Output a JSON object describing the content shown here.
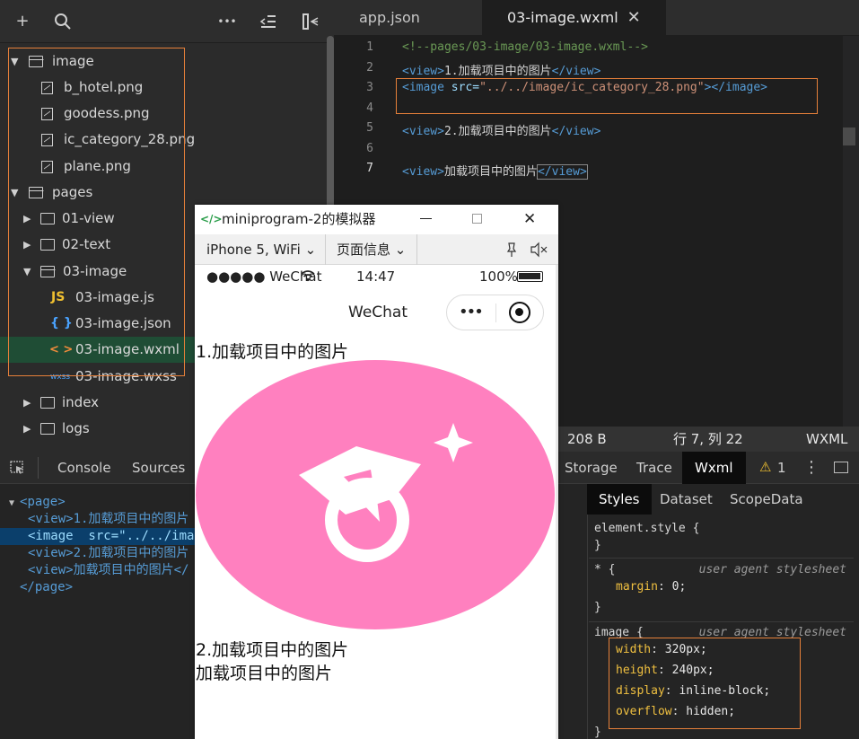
{
  "toolbar": {
    "add": "+",
    "search": "⌕",
    "more": "•••",
    "outdent": "⇤",
    "split": "⫞"
  },
  "tree": {
    "items": [
      {
        "label": "image",
        "icon": "folder-open-icon",
        "expanded": true
      },
      {
        "label": "b_hotel.png",
        "icon": "image-file-icon"
      },
      {
        "label": "goodess.png",
        "icon": "image-file-icon"
      },
      {
        "label": "ic_category_28.png",
        "icon": "image-file-icon"
      },
      {
        "label": "plane.png",
        "icon": "image-file-icon"
      },
      {
        "label": "pages",
        "icon": "folder-open-icon",
        "expanded": true
      },
      {
        "label": "01-view",
        "icon": "folder-icon"
      },
      {
        "label": "02-text",
        "icon": "folder-icon"
      },
      {
        "label": "03-image",
        "icon": "folder-open-icon",
        "expanded": true
      },
      {
        "label": "03-image.js",
        "icon": "js-icon",
        "badge": "JS"
      },
      {
        "label": "03-image.json",
        "icon": "json-icon",
        "badge": "{ }"
      },
      {
        "label": "03-image.wxml",
        "icon": "wxml-icon",
        "badge": "< >",
        "selected": true
      },
      {
        "label": "03-image.wxss",
        "icon": "wxss-icon",
        "badge": "wxss"
      },
      {
        "label": "index",
        "icon": "folder-icon"
      },
      {
        "label": "logs",
        "icon": "folder-icon"
      }
    ]
  },
  "editor": {
    "tabs": [
      {
        "label": "app.json",
        "active": false
      },
      {
        "label": "03-image.wxml",
        "active": true,
        "close": "✕"
      }
    ],
    "line_numbers": [
      "1",
      "2",
      "3",
      "4",
      "5",
      "6",
      "7"
    ],
    "lines": {
      "l1": "<!--pages/03-image/03-image.wxml-->",
      "l2_open": "<view>",
      "l2_text": "1.加载项目中的图片",
      "l2_close": "</view>",
      "l3_open": "<image ",
      "l3_attr": "src=",
      "l3_val": "\"../../image/ic_category_28.png\"",
      "l3_rest": "></image>",
      "l5_open": "<view>",
      "l5_text": "2.加载项目中的图片",
      "l5_close": "</view>",
      "l7_open": "<view>",
      "l7_text": "加载项目中的图片",
      "l7_close": "</view>"
    }
  },
  "statusbar": {
    "size": "208 B",
    "position": "行 7, 列 22",
    "lang": "WXML"
  },
  "devtools": {
    "tabs": [
      "Console",
      "Sources",
      "Storage",
      "Trace",
      "Wxml"
    ],
    "active_tab": "Wxml",
    "warnings": "1",
    "dom": {
      "page_open": "<page>",
      "v1": "<view>1.加载项目中的图片",
      "img": "<image  src=\"../../imag",
      "v2": "<view>2.加载项目中的图片",
      "v3_open": "<view>加载项目中的图片</",
      "page_close": "</page>"
    },
    "subtabs": [
      "Styles",
      "Dataset",
      "ScopeData"
    ],
    "styles": {
      "element_style": "element.style {",
      "close": "}",
      "star_rule": "* {",
      "user_agent": "user agent stylesheet",
      "margin_prop": "margin",
      "margin_val": "0;",
      "image_rule": "image {",
      "props": [
        {
          "name": "width",
          "value": "320px;"
        },
        {
          "name": "height",
          "value": "240px;"
        },
        {
          "name": "display",
          "value": "inline-block;"
        },
        {
          "name": "overflow",
          "value": "hidden;"
        }
      ]
    }
  },
  "simulator": {
    "title": "miniprogram-2的模拟器",
    "device": "iPhone 5, WiFi",
    "page_info": "页面信息",
    "carrier": "●●●●● WeChat",
    "time": "14:47",
    "battery": "100%",
    "nav_title": "WeChat",
    "text1": "1.加载项目中的图片",
    "text2": "2.加载项目中的图片",
    "text3": "加载项目中的图片",
    "image_color": "#ff80bf"
  },
  "colors": {
    "accent_border": "#e6803a",
    "selected_row": "#1f4d35",
    "dom_selected": "#0b3f6b"
  }
}
